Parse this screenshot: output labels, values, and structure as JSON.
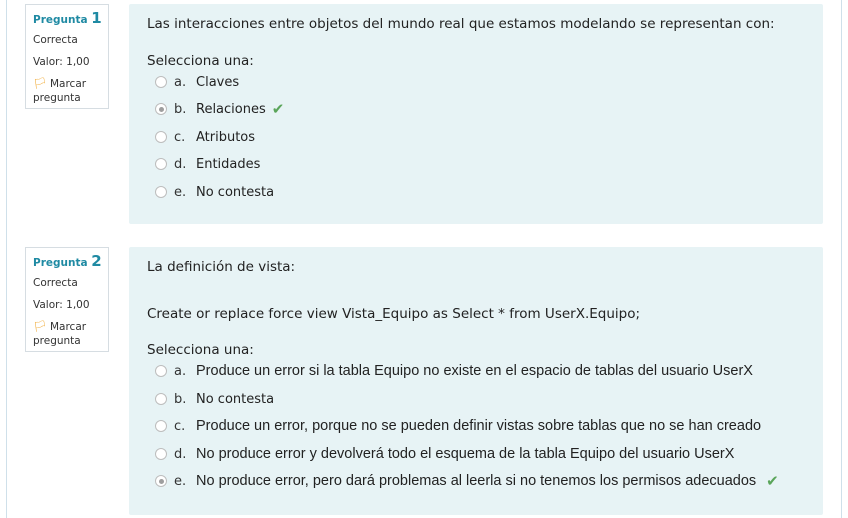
{
  "questions": [
    {
      "title_label": "Pregunta",
      "number": "1",
      "state": "Correcta",
      "grade": "Valor: 1,00",
      "flag_label": "Marcar pregunta",
      "text": "Las interacciones entre objetos del mundo real que estamos modelando se representan con:",
      "prompt": "Selecciona una:",
      "answers": [
        {
          "letter": "a.",
          "label": "Claves"
        },
        {
          "letter": "b.",
          "label": "Relaciones",
          "selected": true,
          "correct": true
        },
        {
          "letter": "c.",
          "label": "Atributos"
        },
        {
          "letter": "d.",
          "label": "Entidades"
        },
        {
          "letter": "e.",
          "label": "No contesta"
        }
      ]
    },
    {
      "title_label": "Pregunta",
      "number": "2",
      "state": "Correcta",
      "grade": "Valor: 1,00",
      "flag_label": "Marcar pregunta",
      "text": "La definición de vista:",
      "code": "Create or replace force view Vista_Equipo as Select * from UserX.Equipo;",
      "prompt": "Selecciona una:",
      "answers": [
        {
          "letter": "a.",
          "label": "Produce un error si la tabla Equipo no existe en el espacio de tablas del usuario UserX"
        },
        {
          "letter": "b.",
          "label": "No contesta"
        },
        {
          "letter": "c.",
          "label": "Produce un error, porque no se pueden definir vistas sobre tablas que no se han creado"
        },
        {
          "letter": "d.",
          "label": "No produce error y devolverá todo el esquema de la tabla Equipo del usuario UserX"
        },
        {
          "letter": "e.",
          "label": "No produce error, pero dará problemas al leerla si no tenemos los permisos adecuados",
          "selected": true,
          "correct": true
        }
      ]
    }
  ],
  "colors": {
    "accent": "#1f8aa3",
    "content_bg": "#e7f3f5",
    "correct": "#5aa55a",
    "flag": "#f0a830"
  },
  "icons": {
    "flag": "flag-icon",
    "correct": "check-icon"
  }
}
